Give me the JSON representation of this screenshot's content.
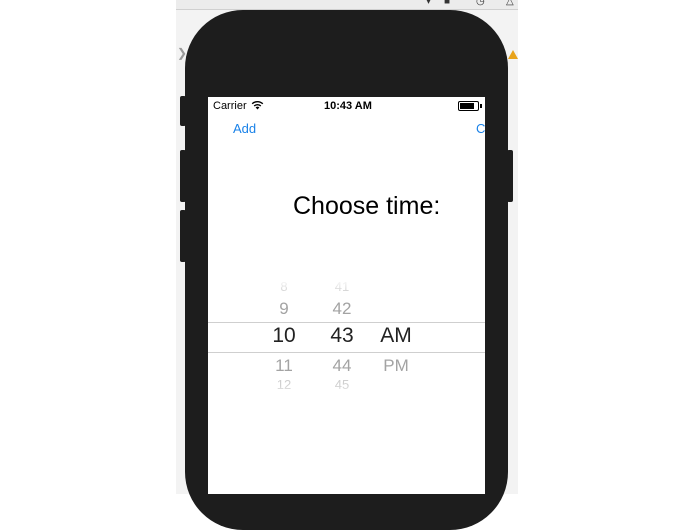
{
  "status_bar": {
    "carrier": "Carrier",
    "time": "10:43 AM"
  },
  "nav": {
    "left_label": "Add",
    "right_label": "C"
  },
  "title": "Choose time:",
  "picker": {
    "hours": [
      "8",
      "9",
      "10",
      "11",
      "12"
    ],
    "minutes": [
      "41",
      "42",
      "43",
      "44",
      "45"
    ],
    "period": [
      "AM",
      "PM"
    ],
    "selected": {
      "hour": "10",
      "minute": "43",
      "period": "AM"
    }
  },
  "icons": {
    "wifi": "wifi-icon",
    "battery": "battery-icon"
  },
  "colors": {
    "accent": "#1a82e8",
    "device_frame": "#1d1d1d"
  }
}
